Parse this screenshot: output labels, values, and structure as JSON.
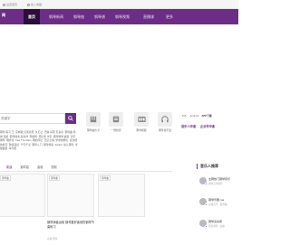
{
  "topbar": {
    "item1": "设置首页",
    "item2": "加入收藏"
  },
  "nav": {
    "logo": "网",
    "items": [
      {
        "label": "首页",
        "active": true
      },
      {
        "label": "钢琴新闻"
      },
      {
        "label": "钢琴曲"
      },
      {
        "label": "钢琴谱"
      },
      {
        "label": "钢琴视频"
      },
      {
        "label": "直播课"
      },
      {
        "label": "更多"
      }
    ]
  },
  "search": {
    "placeholder": "关键字",
    "hot_links": [
      "钢琴 练习 王",
      "宫崎骏 克莱德曼",
      "久石让",
      "巴赫 肖邦 贝多芬",
      "钢琴曲 简单 温柔",
      "钢琴独奏 赵海洋",
      "李斯特",
      "莫扎特 卡农",
      "钢琴教学 曲谱",
      "流行钢琴",
      "理查德",
      "Kiss The Rain",
      "雨的印记",
      "天空之城",
      "梦中的婚礼",
      "菊次郎的夏天",
      "致爱丽丝",
      "千与千寻",
      "钢琴入门",
      "钢琴伴奏",
      "Faded",
      "幼儿钢琴",
      "考级曲目",
      "车尔尼"
    ]
  },
  "quick_links": [
    {
      "label": "钢琴曲大全",
      "icon": "piano-score-icon"
    },
    {
      "label": "一键找谱",
      "icon": "search-score-icon"
    },
    {
      "label": "钢琴视频",
      "icon": "video-icon"
    },
    {
      "label": "钢琴音乐会",
      "icon": "headphones-icon"
    }
  ],
  "app": {
    "ios": "iOS",
    "android": "Android",
    "download": "APP下载",
    "promo_left": "音乐人申请",
    "promo_right": "企业号申请"
  },
  "tabs": [
    "新曲",
    "钢琴曲",
    "曲谱",
    "视频"
  ],
  "cards": [
    {
      "tag": "钢琴曲",
      "title": "",
      "meta": ""
    },
    {
      "tag": "钢琴曲",
      "title": "钢琴演奏运用 钢琴爱好者用的钢琴节奏练习",
      "meta": "古典·钢琴"
    },
    {
      "tag": "钢琴曲",
      "title": "",
      "meta": ""
    }
  ],
  "aside": {
    "title": "音乐人推荐",
    "people": [
      {
        "name": "全网热门钢琴音乐",
        "desc": "钢琴音乐推荐"
      },
      {
        "name": "钢琴乐器.ma",
        "desc": "古典音乐 · 钢琴曲"
      },
      {
        "name": "钢琴演奏者",
        "desc": "原创钢琴 · 改编"
      }
    ]
  },
  "colors": {
    "brand": "#6c2d86",
    "nav_active": "#2b0f3a"
  }
}
